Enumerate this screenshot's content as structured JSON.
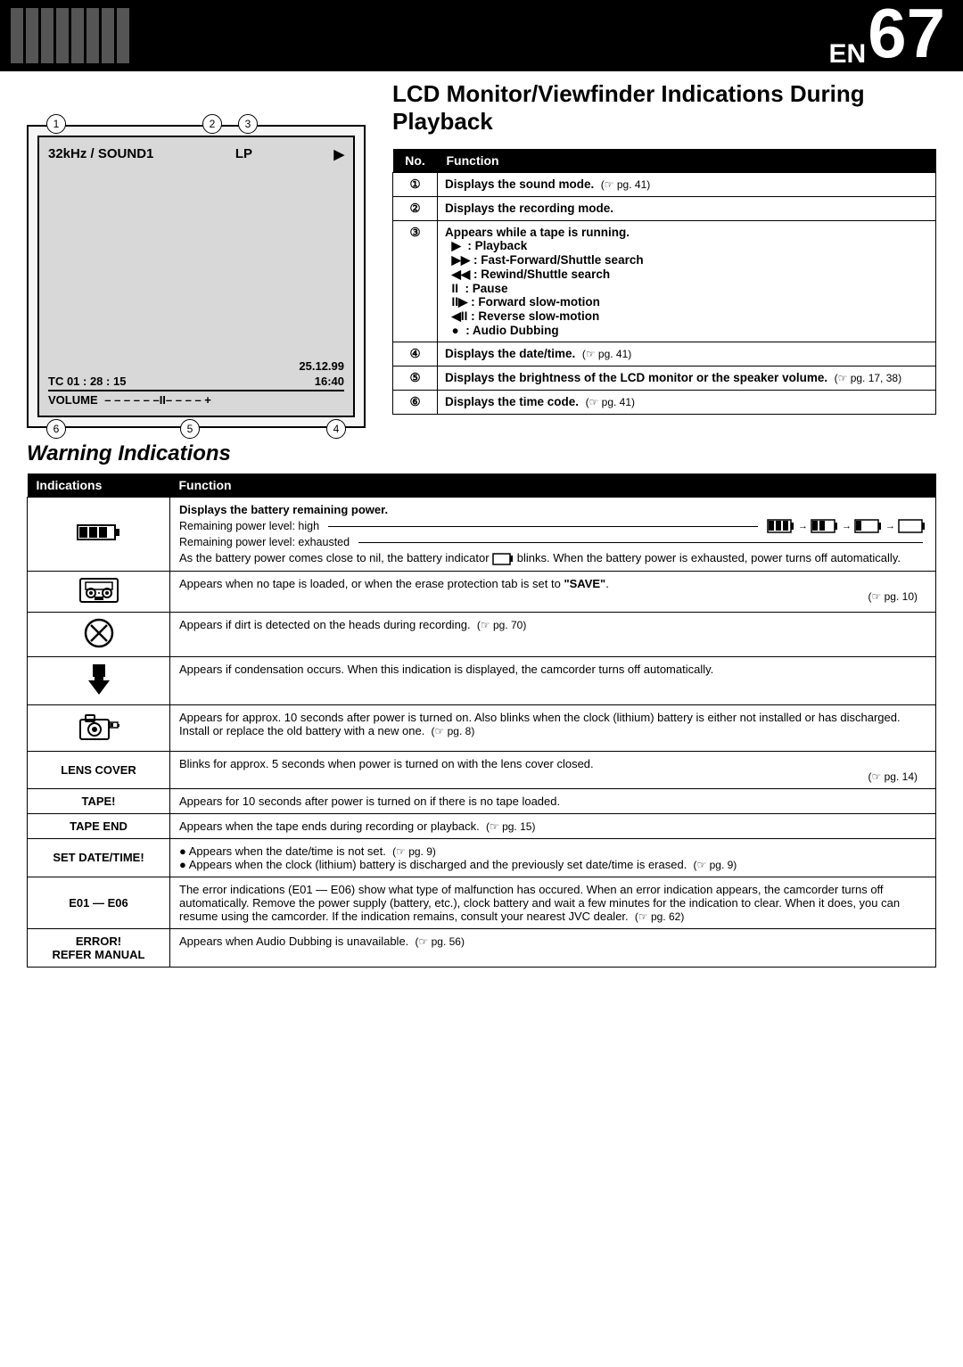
{
  "header": {
    "page_number": "67",
    "en_label": "EN"
  },
  "lcd_section": {
    "title": "LCD Monitor/Viewfinder Indications During Playback",
    "lcd_display": {
      "top_left": "32kHz / SOUND1",
      "top_right": "LP",
      "play_symbol": "▶",
      "date_time": "25.12.99",
      "tc": "TC  01 : 28 : 15",
      "time_right": "16:40",
      "volume_label": "VOLUME",
      "volume_bar": "– – – – – –II– – – – +",
      "callout_1": "1",
      "callout_2": "2",
      "callout_3": "3",
      "callout_4": "4",
      "callout_5": "5",
      "callout_6": "6"
    },
    "table": {
      "col_no": "No.",
      "col_function": "Function",
      "rows": [
        {
          "no": "①",
          "function": "Displays the sound mode.",
          "ref": "(☞ pg. 41)"
        },
        {
          "no": "②",
          "function": "Displays the recording mode.",
          "ref": ""
        },
        {
          "no": "③",
          "function_parts": [
            "Appears while a tape is running.",
            "▶  : Playback",
            "▶▶ : Fast-Forward/Shuttle search",
            "◀◀ : Rewind/Shuttle search",
            "II  : Pause",
            "II▶ : Forward slow-motion",
            "◀II : Reverse slow-motion",
            "●  : Audio Dubbing"
          ],
          "ref": ""
        },
        {
          "no": "④",
          "function": "Displays the date/time.",
          "ref": "(☞ pg. 41)"
        },
        {
          "no": "⑤",
          "function": "Displays the brightness of the LCD monitor or the speaker volume.",
          "ref": "(☞ pg. 17, 38)"
        },
        {
          "no": "⑥",
          "function": "Displays the time code.",
          "ref": "(☞ pg. 41)"
        }
      ]
    }
  },
  "warning_section": {
    "title": "Warning Indications",
    "table": {
      "col_indications": "Indications",
      "col_function": "Function",
      "rows": [
        {
          "id": "battery",
          "indication_type": "battery_icon",
          "function_lines": [
            {
              "bold": true,
              "text": "Displays the battery remaining power."
            },
            {
              "bold": false,
              "text": "Remaining power level: high ——————————————"
            },
            {
              "bold": false,
              "text": "Remaining power level: exhausted———"
            },
            {
              "bold": false,
              "text": "As the battery power comes close to nil, the battery indicator  blinks. When the battery power is exhausted, power turns off automatically."
            }
          ]
        },
        {
          "id": "tape-protect",
          "indication_type": "tape_protect_icon",
          "function": "Appears when no tape is loaded, or when the erase protection tab is set to \"SAVE\".",
          "ref": "(☞ pg. 10)"
        },
        {
          "id": "dirty-heads",
          "indication_type": "circle_x_icon",
          "function": "Appears if dirt is detected on the heads during recording.",
          "ref": "(☞ pg. 70)"
        },
        {
          "id": "condensation",
          "indication_type": "droplet_icon",
          "function": "Appears if condensation occurs. When this indication is displayed, the camcorder turns off automatically.",
          "ref": ""
        },
        {
          "id": "clock-battery",
          "indication_type": "camera_battery_icon",
          "function": "Appears for approx. 10 seconds after power is turned on. Also blinks when the clock (lithium) battery is either not installed or has discharged. Install or replace the old battery with a new one.",
          "ref": "(☞ pg. 8)"
        },
        {
          "id": "lens-cover",
          "indication_type": "text",
          "indication_text": "LENS COVER",
          "function": "Blinks for approx. 5 seconds when power is turned on with the lens cover closed.",
          "ref": "(☞ pg. 14)"
        },
        {
          "id": "tape-warning",
          "indication_type": "text",
          "indication_text": "TAPE!",
          "function": "Appears for 10 seconds after power is turned on if there is no tape loaded.",
          "ref": ""
        },
        {
          "id": "tape-end",
          "indication_type": "text",
          "indication_text": "TAPE END",
          "function": "Appears when the tape ends during recording or playback.",
          "ref": "(☞ pg. 15)"
        },
        {
          "id": "set-date-time",
          "indication_type": "text",
          "indication_text": "SET DATE/TIME!",
          "function_lines": [
            "• Appears when the date/time is not set.  (☞ pg. 9)",
            "• Appears when the clock (lithium) battery is discharged and the previously set date/  time is erased.  (☞ pg. 9)"
          ]
        },
        {
          "id": "e01-e06",
          "indication_type": "text",
          "indication_text": "E01 — E06",
          "function": "The error indications (E01 — E06) show what type of malfunction has occured. When an error indication appears, the camcorder turns off automatically. Remove the power supply (battery, etc.), clock battery and wait a few minutes for the indication to clear. When it does, you can resume using the camcorder. If the indication remains, consult your nearest JVC dealer.",
          "ref": "(☞ pg. 62)"
        },
        {
          "id": "error",
          "indication_type": "text",
          "indication_text": "ERROR!\nREFER MANUAL",
          "function": "Appears when Audio Dubbing is unavailable.",
          "ref": "(☞ pg. 56)"
        }
      ]
    }
  }
}
